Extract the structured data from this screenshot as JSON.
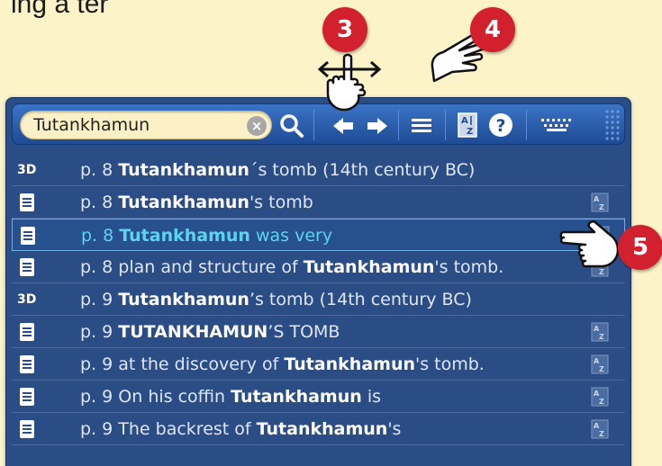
{
  "heading_fragment": "ing a ter",
  "callouts": {
    "c3": "3",
    "c4": "4",
    "c5": "5"
  },
  "search": {
    "value": "Tutankhamun",
    "clear": "×"
  },
  "toolbar": {
    "search_button": "search-icon",
    "prev_button": "arrow-left-icon",
    "next_button": "arrow-right-icon",
    "list_button": "list-icon",
    "sort_button": "az-sort-icon",
    "help_button": "help-icon",
    "keyboard_button": "keyboard-icon"
  },
  "results": [
    {
      "type": "3D",
      "page": "p. 8",
      "pre": "",
      "term": "Tutankhamun",
      "post": "´s tomb (14th century BC)",
      "az": false,
      "selected": false
    },
    {
      "type": "doc",
      "page": "p. 8",
      "pre": "",
      "term": "Tutankhamun",
      "post": "'s tomb",
      "az": true,
      "selected": false
    },
    {
      "type": "doc",
      "page": "p. 8",
      "pre": "",
      "term": "Tutankhamun",
      "post": " was very",
      "az": true,
      "selected": true
    },
    {
      "type": "doc",
      "page": "p. 8",
      "pre": "plan and structure of ",
      "term": "Tutankhamun",
      "post": "'s tomb.",
      "az": true,
      "selected": false
    },
    {
      "type": "3D",
      "page": "p. 9",
      "pre": "",
      "term": "Tutankhamun",
      "post": "’s tomb (14th century BC)",
      "az": false,
      "selected": false
    },
    {
      "type": "doc",
      "page": "p. 9",
      "pre": "",
      "term": "TUTANKHAMUN",
      "post": "’S TOMB",
      "az": true,
      "selected": false
    },
    {
      "type": "doc",
      "page": "p. 9",
      "pre": "at the discovery of ",
      "term": "Tutankhamun",
      "post": "'s tomb.",
      "az": true,
      "selected": false
    },
    {
      "type": "doc",
      "page": "p. 9",
      "pre": "On his coffin ",
      "term": "Tutankhamun",
      "post": " is",
      "az": true,
      "selected": false
    },
    {
      "type": "doc",
      "page": "p. 9",
      "pre": "The backrest of ",
      "term": "Tutankhamun",
      "post": "'s",
      "az": true,
      "selected": false
    }
  ],
  "colors": {
    "badge": "#d3202e",
    "panel": "#2b4d86",
    "highlight": "#5fd3ec",
    "background": "#fdf3c8"
  }
}
